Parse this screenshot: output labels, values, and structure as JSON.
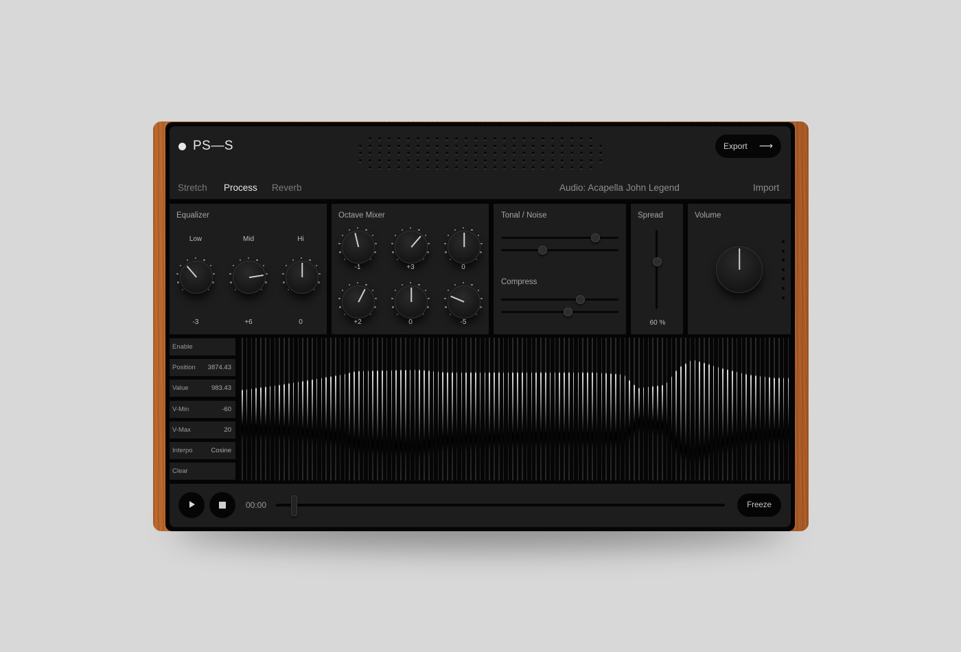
{
  "app": {
    "brand": "PS—S",
    "export_label": "Export",
    "export_icon": "arrow-right-icon",
    "tabs": [
      {
        "label": "Stretch",
        "active": false
      },
      {
        "label": "Process",
        "active": true
      },
      {
        "label": "Reverb",
        "active": false
      }
    ],
    "audio_label": "Audio: Acapella John Legend",
    "import_label": "Import"
  },
  "equalizer": {
    "title": "Equalizer",
    "knobs": [
      {
        "label": "Low",
        "value": "-3"
      },
      {
        "label": "Mid",
        "value": "+6"
      },
      {
        "label": "Hi",
        "value": "0"
      }
    ]
  },
  "octave_mixer": {
    "title": "Octave Mixer",
    "knobs": [
      {
        "value": "-1"
      },
      {
        "value": "+3"
      },
      {
        "value": "0"
      },
      {
        "value": "+2"
      },
      {
        "value": "0"
      },
      {
        "value": "-5"
      }
    ]
  },
  "tonal_noise": {
    "title": "Tonal / Noise",
    "sliders": [
      0.8,
      0.35
    ]
  },
  "compress": {
    "title": "Compress",
    "sliders": [
      0.67,
      0.57
    ]
  },
  "spread": {
    "title": "Spread",
    "value": 0.6,
    "value_label": "60 %"
  },
  "volume": {
    "title": "Volume",
    "value": 0.5
  },
  "params": [
    {
      "label": "Enable",
      "value": ""
    },
    {
      "label": "Position",
      "value": "3874.43"
    },
    {
      "label": "Value",
      "value": "983.43"
    },
    {
      "label": "V-Min",
      "value": "-60"
    },
    {
      "label": "V-Max",
      "value": "20"
    },
    {
      "label": "Interpo",
      "value": "Cosine"
    },
    {
      "label": "Clear",
      "value": ""
    }
  ],
  "transport": {
    "time": "00:00",
    "progress": 0.04,
    "freeze_label": "Freeze",
    "play_icon": "play-icon",
    "stop_icon": "stop-icon"
  },
  "colors": {
    "panel": "#1d1d1d",
    "frame": "#050505",
    "wood": "#c9773a",
    "text_active": "#e8e8e8",
    "text_muted": "#7a7a7a"
  }
}
